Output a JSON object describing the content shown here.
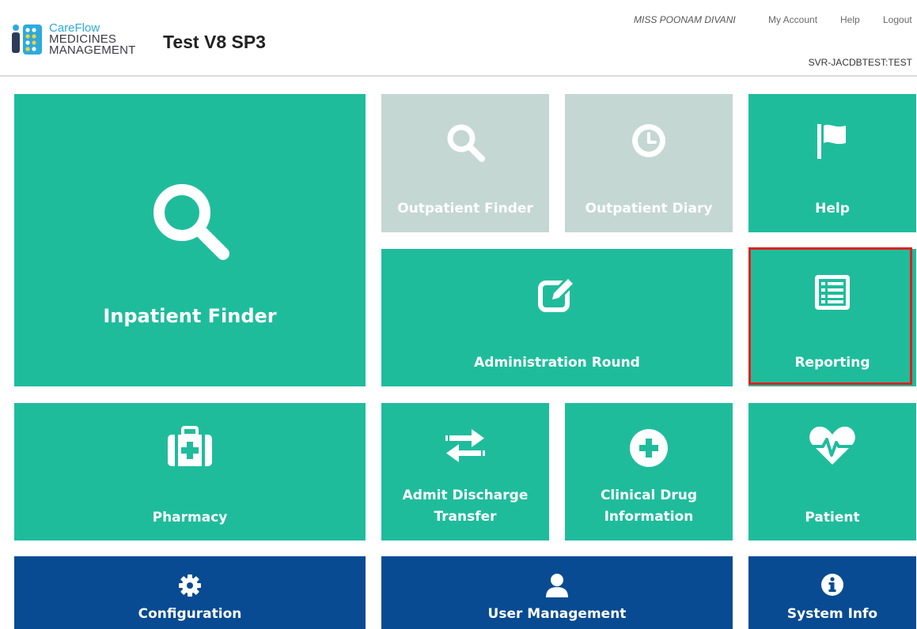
{
  "header": {
    "logo": {
      "line1": "CareFlow",
      "line2": "MEDICINES",
      "line3": "MANAGEMENT"
    },
    "site_title": "Test V8 SP3",
    "user_name": "MISS POONAM DIVANI",
    "links": {
      "my_account": "My Account",
      "help": "Help",
      "logout": "Logout"
    },
    "server": "SVR-JACDBTEST:TEST"
  },
  "tiles": {
    "inpatient_finder": {
      "label": "Inpatient Finder",
      "icon": "search-icon",
      "state": "enabled"
    },
    "outpatient_finder": {
      "label": "Outpatient Finder",
      "icon": "search-icon",
      "state": "disabled"
    },
    "outpatient_diary": {
      "label": "Outpatient Diary",
      "icon": "clock-icon",
      "state": "disabled"
    },
    "help": {
      "label": "Help",
      "icon": "flag-icon",
      "state": "enabled"
    },
    "administration_round": {
      "label": "Administration Round",
      "icon": "edit-icon",
      "state": "enabled"
    },
    "reporting": {
      "label": "Reporting",
      "icon": "list-icon",
      "state": "highlighted"
    },
    "pharmacy": {
      "label": "Pharmacy",
      "icon": "medical-bag-icon",
      "state": "enabled"
    },
    "admit_discharge_transfer": {
      "label_line1": "Admit Discharge",
      "label_line2": "Transfer",
      "icon": "exchange-icon",
      "state": "enabled"
    },
    "clinical_drug_information": {
      "label_line1": "Clinical Drug",
      "label_line2": "Information",
      "icon": "plus-circle-icon",
      "state": "enabled"
    },
    "patient": {
      "label": "Patient",
      "icon": "heartbeat-icon",
      "state": "enabled"
    },
    "configuration": {
      "label": "Configuration",
      "icon": "gear-icon",
      "state": "enabled"
    },
    "user_management": {
      "label": "User Management",
      "icon": "user-icon",
      "state": "enabled"
    },
    "system_info": {
      "label": "System Info",
      "icon": "info-icon",
      "state": "enabled"
    }
  },
  "colors": {
    "tile_green": "#1fbc9c",
    "tile_disabled": "#c4d7d3",
    "tile_blue": "#084b92",
    "highlight_border": "#e0201c",
    "logo_blue": "#2eaadc"
  }
}
